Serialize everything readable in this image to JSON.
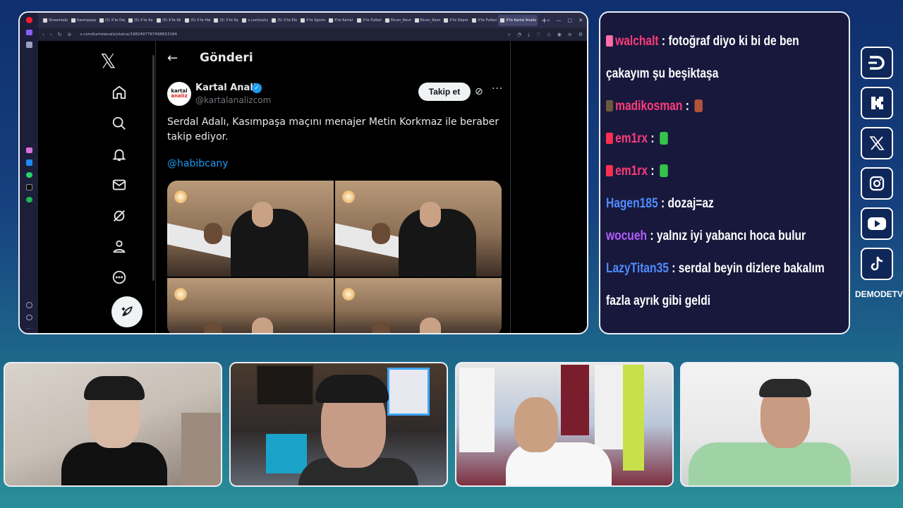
{
  "browser": {
    "tabs": [
      "Streamlabs",
      "Kasımpaşa",
      "(5) X'te Dep",
      "(5) X'te Kar",
      "(5) X'te Ali",
      "(5) X'te Hab",
      "(5) X'te Kar",
      "x.com/sutun",
      "(5) X'te Ebo",
      "X'te Sports",
      "X'te Kartal",
      "X'te Futbol",
      "Ekran_Resm",
      "Ekran_Resm",
      "X'te Deport",
      "X'te Futbol",
      "X'te Kartal Analiz"
    ],
    "active_tab_index": 16,
    "url": "x.com/kartalanaliz/status/1982497767498653184"
  },
  "x": {
    "page_title": "Gönderi",
    "author_name": "Kartal Analiz",
    "author_handle": "@kartalanalizcom",
    "avatar_line1": "kartal",
    "avatar_line2": "analiz",
    "follow_label": "Takip et",
    "tweet_text": "Serdal Adalı, Kasımpaşa maçını menajer Metin Korkmaz ile beraber takip ediyor.",
    "mention": "@habibcany"
  },
  "chat": {
    "messages": [
      {
        "user": "walchalt",
        "color": "#ff3b7a",
        "badge": "#ff6fa8",
        "text": "fotoğraf diyo ki bi de ben çakayım şu beşiktaşa"
      },
      {
        "user": "madikosman",
        "color": "#ff3b7a",
        "badge": "#6b5b3a",
        "text": "",
        "emote": "#b0543a"
      },
      {
        "user": "em1rx",
        "color": "#ff3b7a",
        "badge": "#ff2f4f",
        "text": "",
        "emote": "#35c24a"
      },
      {
        "user": "em1rx",
        "color": "#ff3b7a",
        "badge": "#ff2f4f",
        "text": "",
        "emote": "#35c24a"
      },
      {
        "user": "Hagen185",
        "color": "#4f8cff",
        "text": "dozaj=az"
      },
      {
        "user": "wocueh",
        "color": "#b45cff",
        "text": "yalnız iyi yabancı hoca bulur"
      },
      {
        "user": "LazyTitan35",
        "color": "#4f8cff",
        "text": "serdal beyin dizlere bakalım fazla ayrık gibi geldi"
      }
    ]
  },
  "brand": {
    "label": "DEMODETV"
  }
}
